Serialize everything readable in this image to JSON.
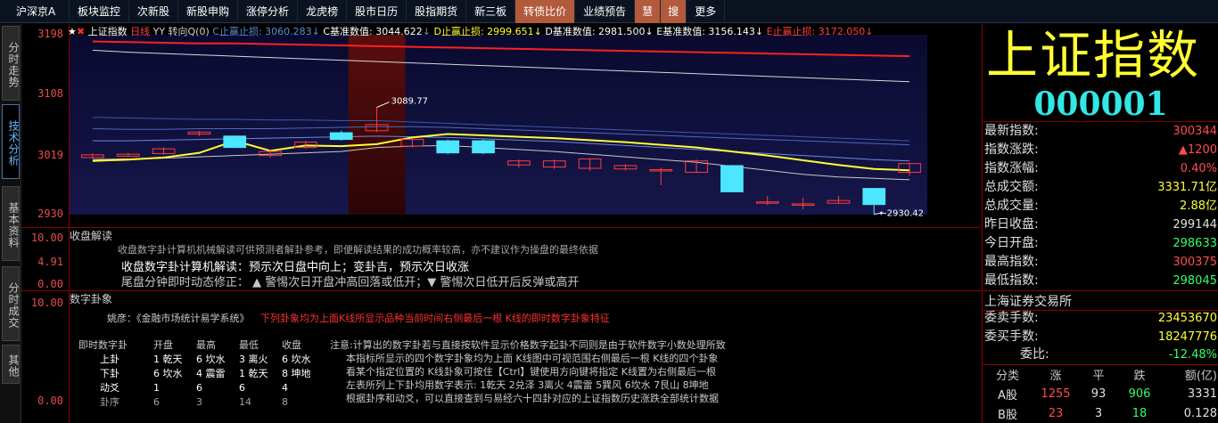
{
  "nav": [
    "沪深京A",
    "板块监控",
    "次新股",
    "新股申购",
    "涨停分析",
    "龙虎榜",
    "股市日历",
    "股指期货",
    "新三板",
    "转债比价",
    "业绩预告",
    "慧",
    "搜",
    "更多"
  ],
  "left_tabs": [
    "分时走势",
    "技术分析",
    "基本资料",
    "分时成交",
    "其他"
  ],
  "chart": {
    "legend": [
      {
        "text": "上证指数",
        "color": "#ffffff"
      },
      {
        "text": "日线",
        "color": "#ff4040"
      },
      {
        "text": "YY 转向Q(0)",
        "color": "#d0d0d0"
      },
      {
        "text": "C止赢止损: 3060.283",
        "color": "#5a8fd8"
      },
      {
        "text": "C基准数值: 3044.622",
        "color": "#ffffff"
      },
      {
        "text": "D止赢止损: 2999.651",
        "color": "#ffff33"
      },
      {
        "text": "D基准数值: 2981.500",
        "color": "#ffffff"
      },
      {
        "text": "E基准数值: 3156.143",
        "color": "#ffffff"
      },
      {
        "text": "E止赢止损: 3172.050",
        "color": "#ff4040"
      }
    ],
    "axis_labels": [
      "3198",
      "3108",
      "3019",
      "2930"
    ],
    "high_label": "3089.77",
    "low_label": "2930.42"
  },
  "chart_data": {
    "type": "candlestick",
    "ylim": [
      2930,
      3198
    ],
    "candles": [
      {
        "o": 3015,
        "c": 3019,
        "h": 3021,
        "l": 3013
      },
      {
        "o": 3017,
        "c": 3020,
        "h": 3022,
        "l": 3016
      },
      {
        "o": 3021,
        "c": 3028,
        "h": 3030,
        "l": 3019
      },
      {
        "o": 3050,
        "c": 3053,
        "h": 3055,
        "l": 3047
      },
      {
        "o": 3047,
        "c": 3030,
        "h": 3048,
        "l": 3029
      },
      {
        "o": 3018,
        "c": 3024,
        "h": 3026,
        "l": 3015
      },
      {
        "o": 3030,
        "c": 3038,
        "h": 3040,
        "l": 3028
      },
      {
        "o": 3052,
        "c": 3042,
        "h": 3055,
        "l": 3040
      },
      {
        "o": 3055,
        "c": 3064,
        "h": 3089.77,
        "l": 3053
      },
      {
        "o": 3032,
        "c": 3042,
        "h": 3044,
        "l": 3030
      },
      {
        "o": 3040,
        "c": 3022,
        "h": 3042,
        "l": 3020
      },
      {
        "o": 3040,
        "c": 3022,
        "h": 3042,
        "l": 3020
      },
      {
        "o": 3004,
        "c": 3010,
        "h": 3012,
        "l": 3000
      },
      {
        "o": 3001,
        "c": 3010,
        "h": 3012,
        "l": 2998
      },
      {
        "o": 2999,
        "c": 3013,
        "h": 3014,
        "l": 2995
      },
      {
        "o": 2998,
        "c": 3003,
        "h": 3005,
        "l": 2996
      },
      {
        "o": 2995,
        "c": 2997,
        "h": 3000,
        "l": 2974
      },
      {
        "o": 2993,
        "c": 3010,
        "h": 3012,
        "l": 2992
      },
      {
        "o": 3003,
        "c": 2964,
        "h": 3004,
        "l": 2963
      },
      {
        "o": 2947,
        "c": 2949,
        "h": 2958,
        "l": 2944
      },
      {
        "o": 2944,
        "c": 2946,
        "h": 2955,
        "l": 2938
      },
      {
        "o": 2947,
        "c": 2951,
        "h": 2958,
        "l": 2946
      },
      {
        "o": 2969,
        "c": 2945,
        "h": 2970,
        "l": 2930.42
      },
      {
        "o": 2993,
        "c": 3006,
        "h": 3008,
        "l": 2988
      }
    ],
    "lines": {
      "red": [
        3188,
        3187,
        3186,
        3185,
        3185,
        3184,
        3183,
        3182,
        3181,
        3180,
        3179,
        3178,
        3177,
        3176,
        3175,
        3174,
        3173,
        3172,
        3171,
        3170,
        3169,
        3168,
        3167,
        3166
      ],
      "white_upper": [
        3175,
        3172,
        3170,
        3168,
        3166,
        3164,
        3162,
        3160,
        3158,
        3156,
        3154,
        3152,
        3150,
        3148,
        3146,
        3144,
        3142,
        3140,
        3138,
        3136,
        3134,
        3132,
        3130,
        3128
      ],
      "blue1": [
        3075,
        3074,
        3073,
        3072,
        3072,
        3071,
        3071,
        3070,
        3070,
        3068,
        3066,
        3064,
        3062,
        3060,
        3058,
        3056,
        3054,
        3052,
        3050,
        3048,
        3046,
        3044,
        3042,
        3040
      ],
      "blue2": [
        3058,
        3057,
        3057,
        3058,
        3058,
        3058,
        3059,
        3060,
        3061,
        3061,
        3060,
        3058,
        3056,
        3054,
        3052,
        3050,
        3048,
        3046,
        3044,
        3042,
        3040,
        3038,
        3036,
        3034
      ],
      "blue3": [
        3040,
        3040,
        3041,
        3042,
        3043,
        3044,
        3045,
        3046,
        3047,
        3046,
        3045,
        3043,
        3041,
        3039,
        3036,
        3033,
        3030,
        3027,
        3024,
        3021,
        3018,
        3015,
        3012,
        3010
      ],
      "yellow": [
        3010,
        3012,
        3015,
        3022,
        3040,
        3025,
        3033,
        3032,
        3035,
        3045,
        3050,
        3048,
        3046,
        3044,
        3041,
        3038,
        3034,
        3030,
        3024,
        3018,
        3011,
        3004,
        2998,
        2996
      ],
      "white_lower": [
        3012,
        3013,
        3014,
        3016,
        3018,
        3020,
        3022,
        3024,
        3030,
        3032,
        3033,
        3030,
        3027,
        3024,
        3020,
        3016,
        3012,
        3008,
        3002,
        2996,
        2990,
        2986,
        2984,
        2982
      ]
    }
  },
  "interp": {
    "title": "收盘解读",
    "axis": [
      "10.00",
      "4.91",
      "0.00"
    ],
    "line1": "收盘数字卦计算机机械解读可供预测者解卦参考，即便解读结果的成功概率较高，亦不建议作为操盘的最终依据",
    "line2": "收盘数字卦计算机解读：预示次日盘中向上；变卦吉，预示次日收涨",
    "line3": "尾盘分钟即时动态修正：  ▲ 警惕次日开盘冲高回落或低开；▼ 警惕次日低开后反弹或高开"
  },
  "gua": {
    "title": "数字卦象",
    "axis": [
      "10.00",
      "0.00"
    ],
    "author": "姚彦：《金融市场统计易学系统》",
    "headline": "下列卦象均为上面K线所显示品种当前时间右侧最后一根 K线的即时数字卦象特征",
    "table_header": [
      "即时数字卦",
      "开盘",
      "最高",
      "最低",
      "收盘"
    ],
    "table_rows": [
      [
        "上卦",
        "1 乾天",
        "6 坎水",
        "3 离火",
        "6 坎水"
      ],
      [
        "下卦",
        "6 坎水",
        "4 震雷",
        "1 乾天",
        "8 坤地"
      ],
      [
        "动爻",
        "1",
        "6",
        "6",
        "4"
      ],
      [
        "卦序",
        "6",
        "3",
        "14",
        "8"
      ]
    ],
    "notes": [
      "注意:计算出的数字卦若与直接按软件显示价格数字起卦不同则是由于软件数字小数处理所致",
      "本指标所显示的四个数字卦象均为上面 K线图中可视范围右侧最后一根 K线的四个卦象",
      "看某个指定位置的 K线卦象可按住【Ctrl】键使用方向键将指定 K线置为右侧最后一根",
      "左表所列上下卦均用数字表示: 1乾天 2兑泽 3离火 4震雷 5巽风 6坎水 7艮山 8坤地",
      "根据卦序和动爻，可以直接查到与易经六十四卦对应的上证指数历史涨跌全部统计数据"
    ]
  },
  "right": {
    "title": "上证指数",
    "code": "000001",
    "stats": [
      {
        "k": "最新指数:",
        "v": "300344",
        "c": "#ff4d4d"
      },
      {
        "k": "指数涨跌:",
        "v": "▲1200",
        "c": "#ff4d4d"
      },
      {
        "k": "指数涨幅:",
        "v": "0.40%",
        "c": "#ff4d4d"
      },
      {
        "k": "总成交额:",
        "v": "3331.71亿",
        "c": "#ffff33"
      },
      {
        "k": "总成交量:",
        "v": "2.88亿",
        "c": "#ffff33"
      },
      {
        "k": "昨日收盘:",
        "v": "299144",
        "c": "#e0e0e0"
      },
      {
        "k": "今日开盘:",
        "v": "298633",
        "c": "#33ff66"
      },
      {
        "k": "最高指数:",
        "v": "300375",
        "c": "#ff4d4d"
      },
      {
        "k": "最低指数:",
        "v": "298045",
        "c": "#33ff66"
      }
    ],
    "exchange": "上海证券交易所",
    "orders": [
      {
        "k": "委卖手数:",
        "v": "23453670",
        "c": "#ffff33"
      },
      {
        "k": "委买手数:",
        "v": "18247776",
        "c": "#ffff33"
      },
      {
        "k": "委比:",
        "v": "-12.48%",
        "c": "#33ff66"
      }
    ],
    "market_header": [
      "分类",
      "涨",
      "平",
      "跌",
      "额(亿)"
    ],
    "market_rows": [
      [
        "A股",
        "1255",
        "93",
        "906",
        "3331"
      ],
      [
        "B股",
        "23",
        "3",
        "18",
        "0.128"
      ]
    ]
  }
}
